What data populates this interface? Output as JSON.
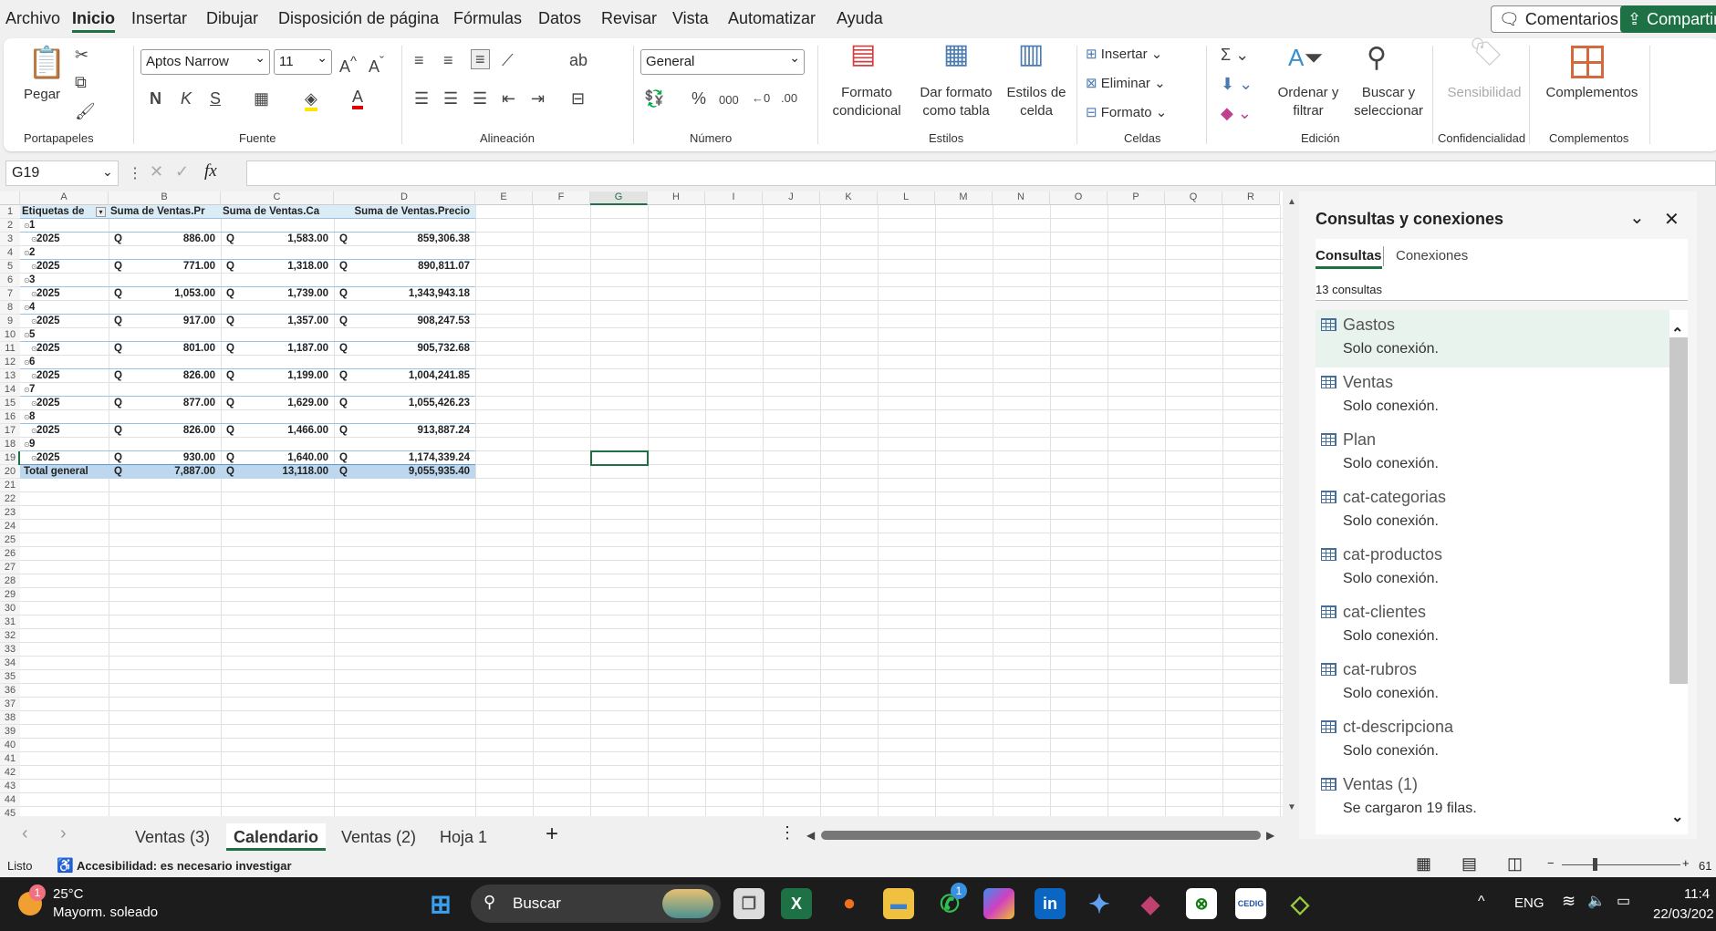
{
  "menu": {
    "items": [
      "Archivo",
      "Inicio",
      "Insertar",
      "Dibujar",
      "Disposición de página",
      "Fórmulas",
      "Datos",
      "Revisar",
      "Vista",
      "Automatizar",
      "Ayuda"
    ],
    "active": 1,
    "comments": "Comentarios",
    "share": "Compartir"
  },
  "ribbon": {
    "clipboard": {
      "paste": "Pegar",
      "label": "Portapapeles"
    },
    "font": {
      "name": "Aptos Narrow",
      "size": "11",
      "bold": "N",
      "italic": "K",
      "underline": "S",
      "label": "Fuente"
    },
    "alignment": {
      "label": "Alineación"
    },
    "number": {
      "format": "General",
      "percent": "%",
      "thousands": "000",
      "label": "Número"
    },
    "styles": {
      "cond": "Formato",
      "cond2": "condicional",
      "table": "Dar formato",
      "table2": "como tabla",
      "cell": "Estilos de",
      "cell2": "celda",
      "label": "Estilos"
    },
    "cells": {
      "insert": "Insertar",
      "delete": "Eliminar",
      "format": "Formato",
      "label": "Celdas"
    },
    "editing": {
      "sort": "Ordenar y",
      "sort2": "filtrar",
      "find": "Buscar y",
      "find2": "seleccionar",
      "label": "Edición"
    },
    "sensitivity": {
      "btn": "Sensibilidad",
      "label": "Confidencialidad"
    },
    "addins": {
      "btn": "Complementos",
      "label": "Complementos"
    }
  },
  "formula": {
    "namebox": "G19",
    "fx": "fx",
    "value": ""
  },
  "grid": {
    "columns": [
      "A",
      "B",
      "C",
      "D",
      "E",
      "F",
      "G",
      "H",
      "I",
      "J",
      "K",
      "L",
      "M",
      "N",
      "O",
      "P",
      "Q",
      "R"
    ],
    "selected_column": "G",
    "selected_cell": "G19",
    "row_count": 45,
    "header": [
      "Etiquetas de",
      "Suma de Ventas.Pr",
      "Suma de Ventas.Ca",
      "Suma de Ventas.Precio"
    ],
    "rows": [
      {
        "label": "1",
        "level": 0
      },
      {
        "label": "2025",
        "level": 1,
        "b": "886.00",
        "c": "1,583.00",
        "d": "859,306.38"
      },
      {
        "label": "2",
        "level": 0
      },
      {
        "label": "2025",
        "level": 1,
        "b": "771.00",
        "c": "1,318.00",
        "d": "890,811.07"
      },
      {
        "label": "3",
        "level": 0
      },
      {
        "label": "2025",
        "level": 1,
        "b": "1,053.00",
        "c": "1,739.00",
        "d": "1,343,943.18"
      },
      {
        "label": "4",
        "level": 0
      },
      {
        "label": "2025",
        "level": 1,
        "b": "917.00",
        "c": "1,357.00",
        "d": "908,247.53"
      },
      {
        "label": "5",
        "level": 0
      },
      {
        "label": "2025",
        "level": 1,
        "b": "801.00",
        "c": "1,187.00",
        "d": "905,732.68"
      },
      {
        "label": "6",
        "level": 0
      },
      {
        "label": "2025",
        "level": 1,
        "b": "826.00",
        "c": "1,199.00",
        "d": "1,004,241.85"
      },
      {
        "label": "7",
        "level": 0
      },
      {
        "label": "2025",
        "level": 1,
        "b": "877.00",
        "c": "1,629.00",
        "d": "1,055,426.23"
      },
      {
        "label": "8",
        "level": 0
      },
      {
        "label": "2025",
        "level": 1,
        "b": "826.00",
        "c": "1,466.00",
        "d": "913,887.24"
      },
      {
        "label": "9",
        "level": 0
      },
      {
        "label": "2025",
        "level": 1,
        "b": "930.00",
        "c": "1,640.00",
        "d": "1,174,339.24"
      }
    ],
    "currency": "Q",
    "total": {
      "label": "Total general",
      "b": "7,887.00",
      "c": "13,118.00",
      "d": "9,055,935.40"
    }
  },
  "panel": {
    "title": "Consultas y conexiones",
    "tabs": [
      "Consultas",
      "Conexiones"
    ],
    "count": "13 consultas",
    "queries": [
      {
        "name": "Gastos",
        "status": "Solo conexión."
      },
      {
        "name": "Ventas",
        "status": "Solo conexión."
      },
      {
        "name": "Plan",
        "status": "Solo conexión."
      },
      {
        "name": "cat-categorias",
        "status": "Solo conexión."
      },
      {
        "name": "cat-productos",
        "status": "Solo conexión."
      },
      {
        "name": "cat-clientes",
        "status": "Solo conexión."
      },
      {
        "name": "cat-rubros",
        "status": "Solo conexión."
      },
      {
        "name": "ct-descripciona",
        "status": "Solo conexión."
      },
      {
        "name": "Ventas (1)",
        "status": "Se cargaron 19 filas."
      }
    ]
  },
  "sheets": {
    "tabs": [
      "Ventas (3)",
      "Calendario",
      "Ventas (2)",
      "Hoja 1"
    ],
    "active": 1,
    "add": "+"
  },
  "status": {
    "ready": "Listo",
    "accessibility": "Accesibilidad: es necesario investigar",
    "zoom": "61"
  },
  "taskbar": {
    "temp": "25°C",
    "weather": "Mayorm. soleado",
    "weather_badge": "1",
    "search": "Buscar",
    "whatsapp_badge": "1",
    "lang": "ENG",
    "time": "11:4",
    "date": "22/03/202"
  }
}
